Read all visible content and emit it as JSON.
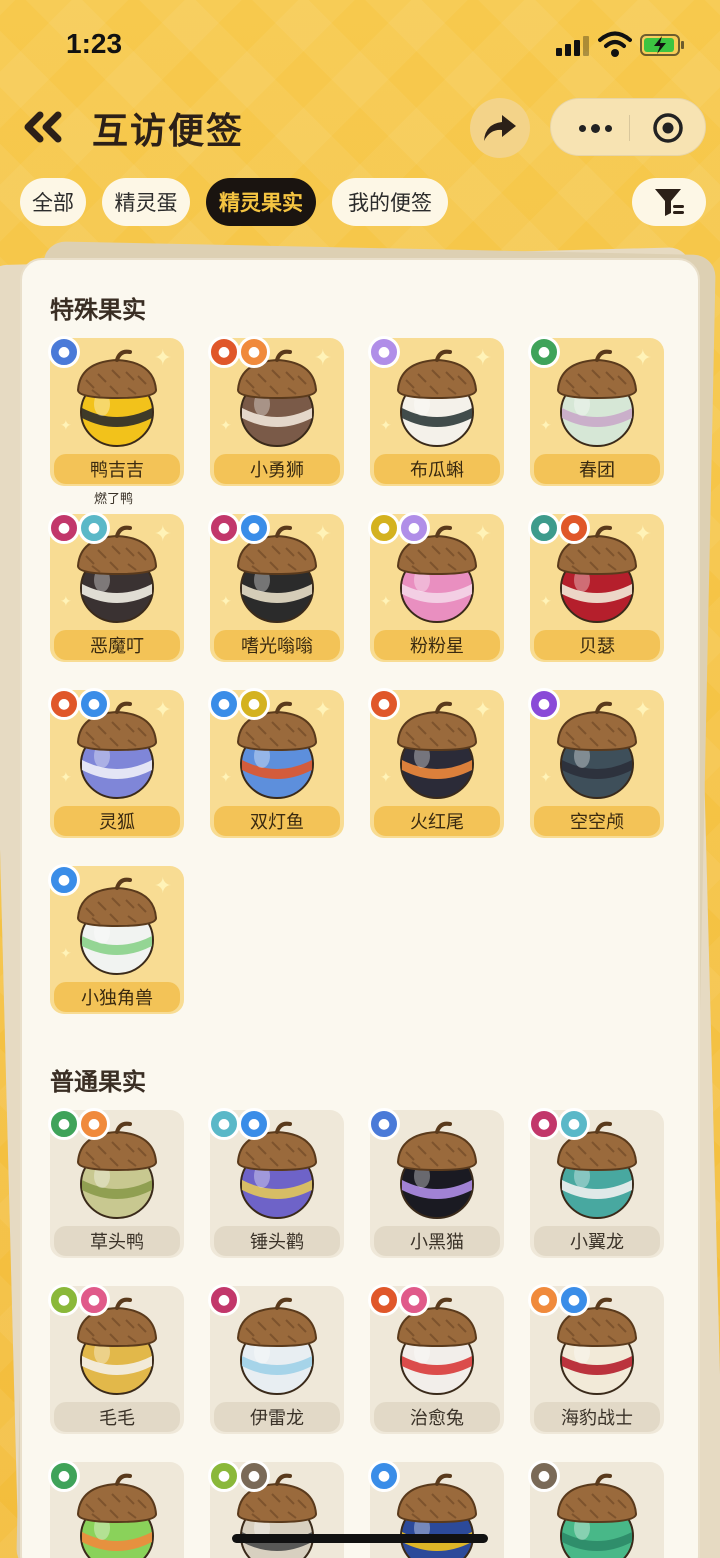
{
  "status_bar": {
    "time": "1:23"
  },
  "header": {
    "title": "互访便签"
  },
  "tabs": [
    {
      "label": "全部",
      "active": false
    },
    {
      "label": "精灵蛋",
      "active": false
    },
    {
      "label": "精灵果实",
      "active": true
    },
    {
      "label": "我的便签",
      "active": false
    }
  ],
  "sections": {
    "special": {
      "title": "特殊果实",
      "items": [
        {
          "name": "鸭吉吉",
          "owner": "燃了鸭",
          "badges": [
            "#4a7ad8"
          ],
          "shell": "#f2c21b",
          "band": "#2b2b2b"
        },
        {
          "name": "小勇狮",
          "badges": [
            "#e0572a",
            "#f08a3c"
          ],
          "shell": "#7a5a48",
          "band": "#efe4d8"
        },
        {
          "name": "布瓜蝌",
          "badges": [
            "#b08ee8"
          ],
          "shell": "#f4f1ea",
          "band": "#2e3a3a"
        },
        {
          "name": "春团",
          "badges": [
            "#3fa35a"
          ],
          "shell": "#d6e7d6",
          "band": "#c9a8c9"
        },
        {
          "name": "恶魔叮",
          "badges": [
            "#c2376b",
            "#5ab8c8"
          ],
          "shell": "#3a3232",
          "band": "#f3efe6"
        },
        {
          "name": "嗜光嗡嗡",
          "badges": [
            "#c2376b",
            "#3a8de8"
          ],
          "shell": "#2b2b2b",
          "band": "#e8dfc8"
        },
        {
          "name": "粉粉星",
          "badges": [
            "#d4b21f",
            "#b08ee8"
          ],
          "shell": "#e98fc0",
          "band": "#f4d6e8"
        },
        {
          "name": "贝瑟",
          "badges": [
            "#3d9b8c",
            "#e0572a"
          ],
          "shell": "#b51f2c",
          "band": "#f2ead8"
        },
        {
          "name": "灵狐",
          "badges": [
            "#e0572a",
            "#3a8de8"
          ],
          "shell": "#7f86d8",
          "band": "#f0f0f8"
        },
        {
          "name": "双灯鱼",
          "badges": [
            "#3a8de8",
            "#d4b21f"
          ],
          "shell": "#5d8fdc",
          "band": "#e0572a"
        },
        {
          "name": "火红尾",
          "badges": [
            "#e0572a"
          ],
          "shell": "#2b2b38",
          "band": "#f08a3c"
        },
        {
          "name": "空空颅",
          "badges": [
            "#8a4ad8"
          ],
          "shell": "#3e4f5a",
          "band": "#2b2f3a"
        },
        {
          "name": "小独角兽",
          "badges": [
            "#3a8de8"
          ],
          "shell": "#f1f3f1",
          "band": "#8ad28a"
        }
      ]
    },
    "normal": {
      "title": "普通果实",
      "items": [
        {
          "name": "草头鸭",
          "badges": [
            "#3fa35a",
            "#f08a3c"
          ],
          "shell": "#c8c890",
          "band": "#8a9a4a"
        },
        {
          "name": "锤头鹳",
          "badges": [
            "#5ab8c8",
            "#3a8de8"
          ],
          "shell": "#6e63c8",
          "band": "#e2c65a"
        },
        {
          "name": "小黑猫",
          "badges": [
            "#4a7ad8"
          ],
          "shell": "#1a1a22",
          "band": "#b08ee8"
        },
        {
          "name": "小翼龙",
          "badges": [
            "#c2376b",
            "#5ab8c8"
          ],
          "shell": "#48a8a0",
          "band": "#f0f0f0"
        },
        {
          "name": "毛毛",
          "badges": [
            "#8ab83a",
            "#e05a8a"
          ],
          "shell": "#e2b84a",
          "band": "#f4f0e8"
        },
        {
          "name": "伊雷龙",
          "badges": [
            "#c2376b"
          ],
          "shell": "#e8eef2",
          "band": "#9fd0e8"
        },
        {
          "name": "治愈兔",
          "badges": [
            "#e0572a",
            "#e05a8a"
          ],
          "shell": "#f2eeea",
          "band": "#d83a3a"
        },
        {
          "name": "海豹战士",
          "badges": [
            "#f08a3c",
            "#3a8de8"
          ],
          "shell": "#f2ead8",
          "band": "#b51f2c"
        },
        {
          "name": "",
          "badges": [
            "#3fa35a"
          ],
          "shell": "#8ad25a",
          "band": "#f08a3c"
        },
        {
          "name": "",
          "badges": [
            "#8ab83a",
            "#7a6a58"
          ],
          "shell": "#d8d0c0",
          "band": "#4a4a4a"
        },
        {
          "name": "",
          "badges": [
            "#3a8de8"
          ],
          "shell": "#2c4a9a",
          "band": "#f2c21b"
        },
        {
          "name": "",
          "badges": [
            "#7a6a58"
          ],
          "shell": "#48b888",
          "band": "#2c8a68"
        }
      ]
    }
  }
}
